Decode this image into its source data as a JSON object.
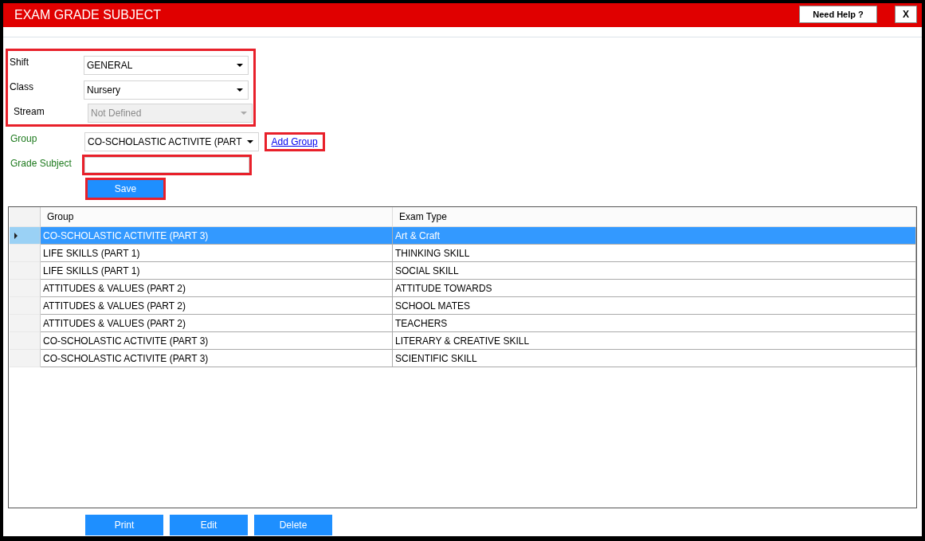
{
  "window": {
    "title": "EXAM GRADE SUBJECT",
    "help_button": "Need Help ?",
    "close_button": "X"
  },
  "form": {
    "field_groups": [
      {
        "highlighted": true,
        "fields": [
          {
            "label": "Shift",
            "value": "GENERAL",
            "disabled": false
          },
          {
            "label": "Class",
            "value": "Nursery",
            "disabled": false
          },
          {
            "label": "Stream",
            "value": "Not Defined",
            "disabled": true
          }
        ]
      },
      {
        "highlighted": false,
        "fields": [
          {
            "label": "Group",
            "value": "CO-SCHOLASTIC ACTIVITE (PART",
            "disabled": false
          }
        ]
      }
    ],
    "add_group_link": {
      "label": "Add Group",
      "highlighted": true
    },
    "grade_subject": {
      "label": "Grade Subject",
      "highlighted": true
    },
    "save_button": {
      "label": "Save",
      "highlighted": true
    }
  },
  "table": {
    "columns": [
      "Group",
      "Exam Type"
    ],
    "rows": [
      {
        "cells": [
          "CO-SCHOLASTIC ACTIVITE (PART 3)",
          "Art & Craft"
        ],
        "selected": true
      },
      {
        "cells": [
          "LIFE SKILLS (PART 1)",
          "THINKING SKILL"
        ],
        "selected": false
      },
      {
        "cells": [
          "LIFE SKILLS (PART 1)",
          "SOCIAL SKILL"
        ],
        "selected": false
      },
      {
        "cells": [
          "ATTITUDES & VALUES (PART 2)",
          "ATTITUDE TOWARDS"
        ],
        "selected": false
      },
      {
        "cells": [
          "ATTITUDES & VALUES (PART 2)",
          "SCHOOL MATES"
        ],
        "selected": false
      },
      {
        "cells": [
          "ATTITUDES & VALUES (PART 2)",
          "TEACHERS"
        ],
        "selected": false
      },
      {
        "cells": [
          "CO-SCHOLASTIC ACTIVITE (PART 3)",
          "LITERARY & CREATIVE SKILL"
        ],
        "selected": false
      },
      {
        "cells": [
          "CO-SCHOLASTIC ACTIVITE (PART 3)",
          "SCIENTIFIC SKILL"
        ],
        "selected": false
      }
    ]
  },
  "buttons": [
    "Print",
    "Edit",
    "Delete"
  ]
}
